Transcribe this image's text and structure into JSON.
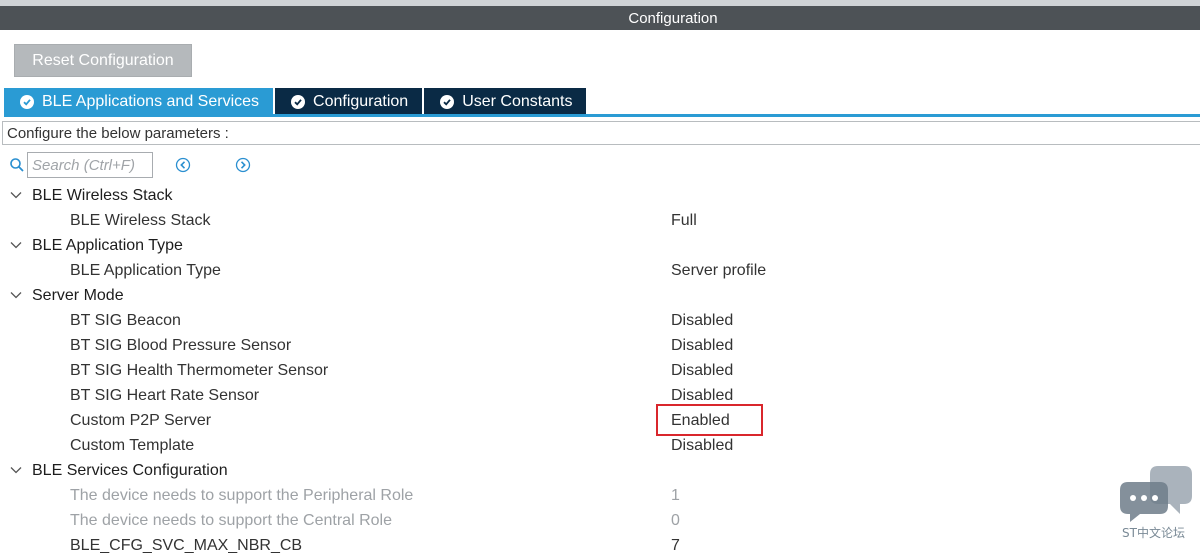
{
  "window": {
    "title": "Configuration"
  },
  "toolbar": {
    "reset_label": "Reset Configuration"
  },
  "tabs": [
    {
      "label": "BLE Applications and Services",
      "active": true
    },
    {
      "label": "Configuration",
      "active": false
    },
    {
      "label": "User Constants",
      "active": false
    }
  ],
  "panel": {
    "instruction": "Configure the below parameters :",
    "search_placeholder": "Search (Ctrl+F)"
  },
  "tree": {
    "group_ble_wireless_stack": "BLE Wireless Stack",
    "row_ble_wireless_stack": {
      "name": "BLE Wireless Stack",
      "value": "Full"
    },
    "group_ble_application_type": "BLE Application Type",
    "row_ble_application_type": {
      "name": "BLE Application Type",
      "value": "Server profile"
    },
    "group_server_mode": "Server Mode",
    "row_beacon": {
      "name": "BT SIG Beacon",
      "value": "Disabled"
    },
    "row_blood_pressure": {
      "name": "BT SIG Blood Pressure Sensor",
      "value": "Disabled"
    },
    "row_health_thermometer": {
      "name": "BT SIG Health Thermometer Sensor",
      "value": "Disabled"
    },
    "row_heart_rate": {
      "name": "BT SIG Heart Rate Sensor",
      "value": "Disabled"
    },
    "row_custom_p2p": {
      "name": "Custom P2P Server",
      "value": "Enabled"
    },
    "row_custom_template": {
      "name": "Custom Template",
      "value": "Disabled"
    },
    "group_ble_services_config": "BLE Services Configuration",
    "row_peripheral_role": {
      "name": "The device needs to support the Peripheral Role",
      "value": "1"
    },
    "row_central_role": {
      "name": "The device needs to support the Central Role",
      "value": "0"
    },
    "row_cfg_svc_max": {
      "name": "BLE_CFG_SVC_MAX_NBR_CB",
      "value": "7"
    }
  },
  "watermark": {
    "text": "ST中文论坛"
  },
  "colors": {
    "titlebar": "#4d5256",
    "tab_active": "#2a9bd4",
    "tab_inactive": "#0a2a45",
    "highlight": "#d9262c"
  },
  "icons": {
    "tab_check": "check-circle-icon",
    "search": "search-icon",
    "previous": "circle-chevron-left-icon",
    "next": "circle-chevron-right-icon",
    "expand": "chevron-down-icon",
    "watermark": "chat-bubbles-icon"
  }
}
